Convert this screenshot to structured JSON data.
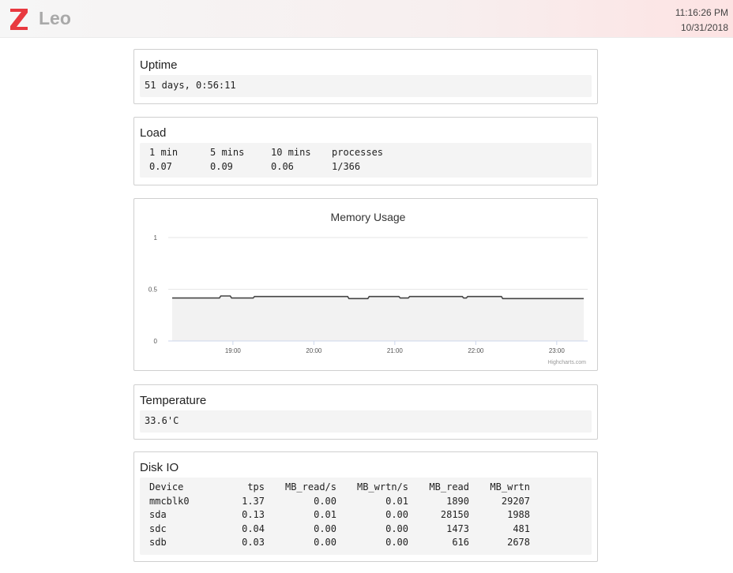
{
  "header": {
    "app_name": "Leo",
    "time": "11:16:26 PM",
    "date": "10/31/2018",
    "logo_color": "#e8393f"
  },
  "uptime": {
    "title": "Uptime",
    "value": "51 days, 0:56:11"
  },
  "load": {
    "title": "Load",
    "headers": [
      "1 min",
      "5 mins",
      "10 mins",
      "processes"
    ],
    "values": [
      "0.07",
      "0.09",
      "0.06",
      "1/366"
    ]
  },
  "memory": {
    "title": "Memory Usage",
    "credit": "Highcharts.com"
  },
  "temperature": {
    "title": "Temperature",
    "value": "33.6'C"
  },
  "disk": {
    "title": "Disk IO",
    "headers": [
      "Device",
      "tps",
      "MB_read/s",
      "MB_wrtn/s",
      "MB_read",
      "MB_wrtn"
    ],
    "rows": [
      [
        "mmcblk0",
        "1.37",
        "0.00",
        "0.01",
        "1890",
        "29207"
      ],
      [
        "sda",
        "0.13",
        "0.01",
        "0.00",
        "28150",
        "1988"
      ],
      [
        "sdc",
        "0.04",
        "0.00",
        "0.00",
        "1473",
        "481"
      ],
      [
        "sdb",
        "0.03",
        "0.00",
        "0.00",
        "616",
        "2678"
      ]
    ]
  },
  "chart_data": {
    "type": "area",
    "title": "Memory Usage",
    "xlabel": "",
    "ylabel": "",
    "ylim": [
      0,
      1
    ],
    "yticks": [
      "0",
      "0.5",
      "1"
    ],
    "xlim": [
      "18:15",
      "23:20"
    ],
    "xticks": [
      "19:00",
      "20:00",
      "21:00",
      "22:00",
      "23:00"
    ],
    "grid": true,
    "legend": "none",
    "line_color": "#444444",
    "fill_color": "#f2f2f2",
    "series": [
      {
        "x": [
          "18:15",
          "18:50",
          "18:51",
          "18:58",
          "18:59",
          "19:15",
          "19:16",
          "20:25",
          "20:26",
          "20:40",
          "20:41",
          "21:03",
          "21:04",
          "21:10",
          "21:11",
          "21:50",
          "21:51",
          "21:53",
          "21:54",
          "22:19",
          "22:20",
          "22:25",
          "22:26",
          "23:20"
        ],
        "values": [
          0.415,
          0.415,
          0.435,
          0.435,
          0.415,
          0.415,
          0.43,
          0.43,
          0.41,
          0.41,
          0.43,
          0.43,
          0.415,
          0.415,
          0.43,
          0.43,
          0.415,
          0.415,
          0.43,
          0.43,
          0.41,
          0.41,
          0.41,
          0.41
        ]
      }
    ]
  }
}
